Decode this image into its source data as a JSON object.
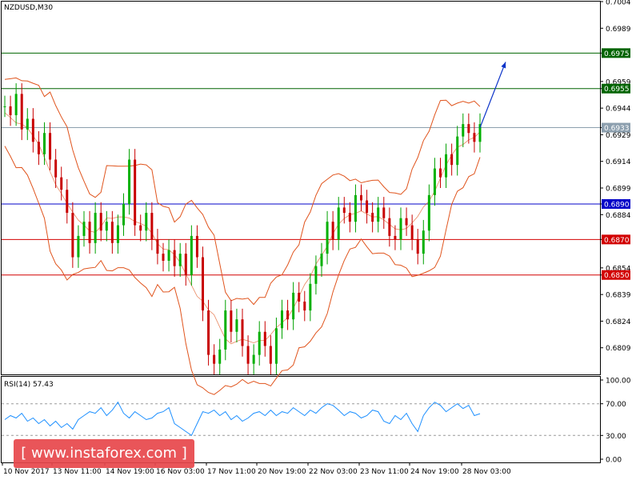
{
  "chart_data": {
    "type": "line",
    "symbol": "NZDUSD,M30",
    "price_axis": {
      "ylim": [
        0.6794,
        0.7004
      ],
      "ticks": [
        "0.7004",
        "0.6989",
        "0.6975",
        "0.6959",
        "0.6955",
        "0.6944",
        "0.6933",
        "0.6929",
        "0.6914",
        "0.6899",
        "0.6890",
        "0.6884",
        "0.6870",
        "0.6854",
        "0.6850",
        "0.6839",
        "0.6824",
        "0.6809"
      ]
    },
    "levels": [
      {
        "price": 0.6975,
        "label": "0.6975",
        "color": "#006400"
      },
      {
        "price": 0.6955,
        "label": "0.6955",
        "color": "#006400"
      },
      {
        "price": 0.6933,
        "label": "0.6933",
        "color": "#8c9fae"
      },
      {
        "price": 0.689,
        "label": "0.6890",
        "color": "#0000c8"
      },
      {
        "price": 0.687,
        "label": "0.6870",
        "color": "#d20000"
      },
      {
        "price": 0.685,
        "label": "0.6850",
        "color": "#d20000"
      }
    ],
    "time_labels": [
      "10 Nov 2017",
      "13 Nov 11:00",
      "14 Nov 19:00",
      "16 Nov 03:00",
      "17 Nov 11:00",
      "20 Nov 19:00",
      "22 Nov 03:00",
      "23 Nov 11:00",
      "24 Nov 19:00",
      "28 Nov 03:00"
    ],
    "price_series": [
      0.6945,
      0.694,
      0.6952,
      0.6932,
      0.6938,
      0.6925,
      0.6918,
      0.693,
      0.6915,
      0.6905,
      0.6898,
      0.6885,
      0.686,
      0.6872,
      0.688,
      0.6868,
      0.6885,
      0.6875,
      0.688,
      0.6868,
      0.6878,
      0.689,
      0.6915,
      0.6878,
      0.6875,
      0.6885,
      0.687,
      0.6862,
      0.6858,
      0.6864,
      0.6855,
      0.6862,
      0.685,
      0.6872,
      0.686,
      0.683,
      0.6805,
      0.68,
      0.6808,
      0.683,
      0.6818,
      0.6825,
      0.681,
      0.68,
      0.6805,
      0.6818,
      0.681,
      0.68,
      0.682,
      0.683,
      0.6825,
      0.684,
      0.6835,
      0.683,
      0.6845,
      0.6855,
      0.6862,
      0.688,
      0.687,
      0.6888,
      0.6885,
      0.688,
      0.6895,
      0.6892,
      0.6885,
      0.688,
      0.6888,
      0.6882,
      0.6872,
      0.687,
      0.6882,
      0.6878,
      0.687,
      0.6862,
      0.6875,
      0.6895,
      0.691,
      0.6905,
      0.6918,
      0.6912,
      0.6928,
      0.6935,
      0.693,
      0.6925,
      0.6935
    ],
    "projection": {
      "from": 0.6933,
      "to": 0.697
    },
    "rsi": {
      "label": "RSI(14) 57.43",
      "ticks": [
        "100.00",
        "70.00",
        "30.00",
        "0.00"
      ],
      "levels": [
        70,
        30
      ],
      "values": [
        50,
        55,
        52,
        58,
        48,
        52,
        45,
        50,
        42,
        48,
        40,
        45,
        38,
        50,
        55,
        60,
        58,
        65,
        55,
        62,
        72,
        58,
        52,
        60,
        55,
        50,
        52,
        58,
        60,
        65,
        45,
        40,
        35,
        30,
        45,
        60,
        58,
        62,
        55,
        60,
        50,
        55,
        48,
        52,
        58,
        60,
        55,
        62,
        55,
        60,
        58,
        65,
        60,
        55,
        62,
        58,
        65,
        70,
        68,
        62,
        55,
        60,
        58,
        52,
        55,
        62,
        60,
        48,
        45,
        55,
        50,
        58,
        45,
        35,
        55,
        65,
        72,
        68,
        60,
        65,
        70,
        64,
        68,
        55,
        57.43
      ]
    },
    "watermark": "[ www.instaforex.com ]"
  }
}
